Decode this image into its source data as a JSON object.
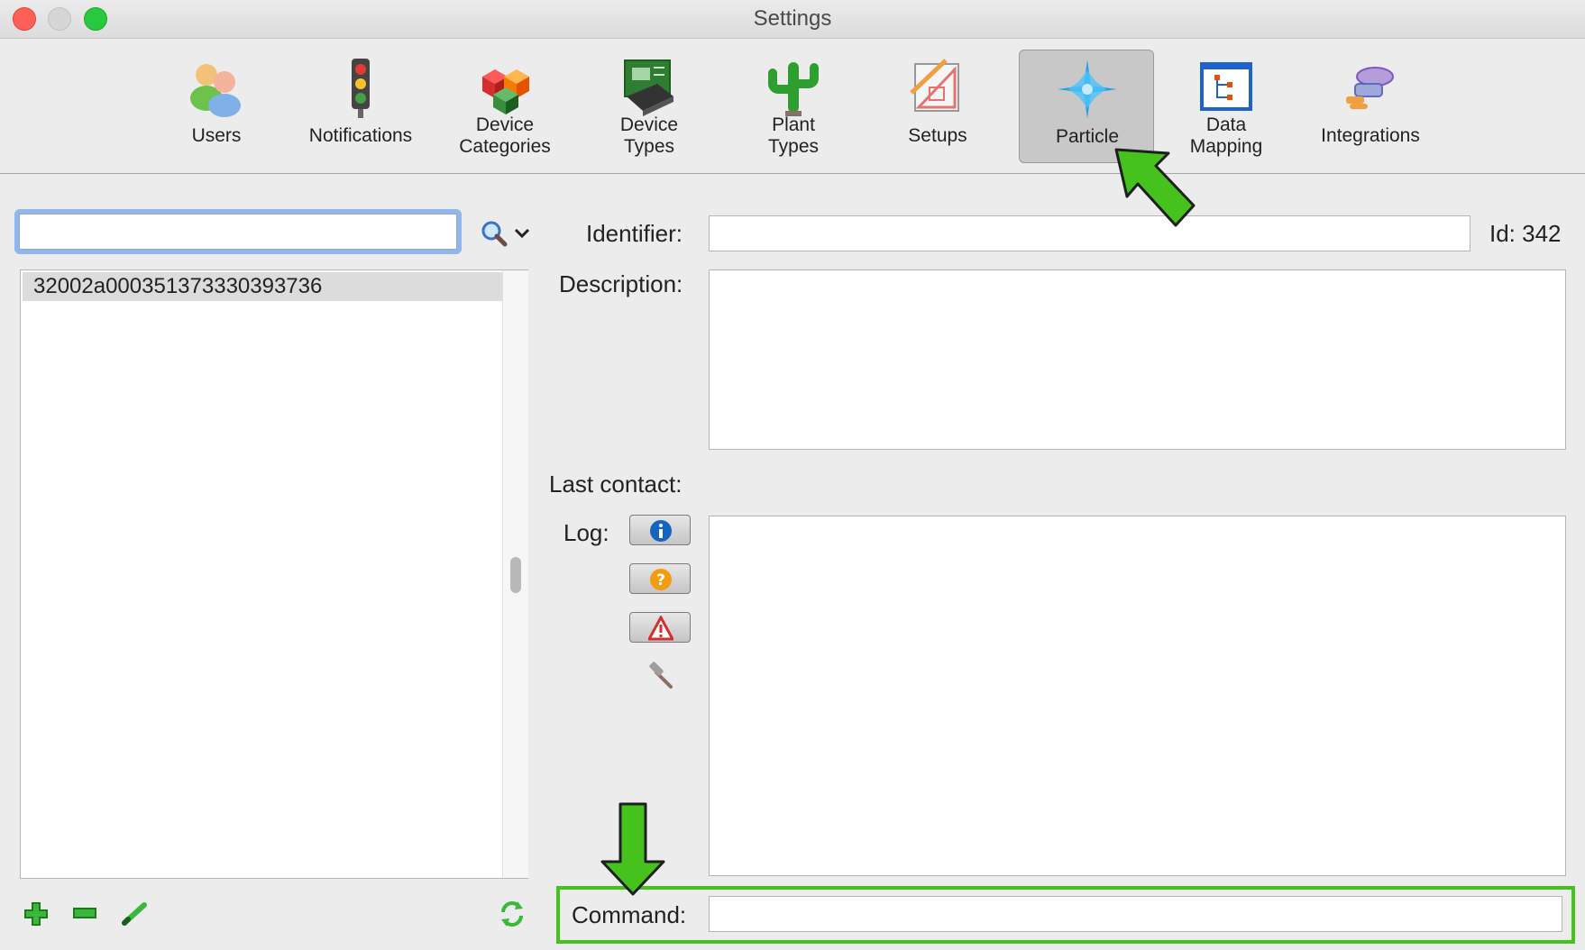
{
  "window": {
    "title": "Settings"
  },
  "toolbar": {
    "items": [
      {
        "label": "Users",
        "icon": "users-icon"
      },
      {
        "label": "Notifications",
        "icon": "traffic-light-icon"
      },
      {
        "label": "Device\nCategories",
        "icon": "cubes-icon"
      },
      {
        "label": "Device\nTypes",
        "icon": "circuit-board-icon"
      },
      {
        "label": "Plant\nTypes",
        "icon": "cactus-icon"
      },
      {
        "label": "Setups",
        "icon": "drafting-icon"
      },
      {
        "label": "Particle",
        "icon": "particle-star-icon",
        "selected": true
      },
      {
        "label": "Data\nMapping",
        "icon": "data-mapping-icon"
      },
      {
        "label": "Integrations",
        "icon": "plug-icon"
      }
    ]
  },
  "sidebar": {
    "search_value": "",
    "list": [
      {
        "id": "32002a000351373330393736"
      }
    ]
  },
  "form": {
    "identifier_label": "Identifier:",
    "identifier_value": "",
    "id_text": "Id: 342",
    "description_label": "Description:",
    "description_value": "",
    "last_contact_label": "Last contact:",
    "last_contact_value": "",
    "log_label": "Log:",
    "log_value": "",
    "command_label": "Command:",
    "command_value": ""
  },
  "colors": {
    "accent_green": "#46c21c",
    "selection_focus": "#8fb7ee",
    "selected_tab": "#c8c8c8"
  }
}
